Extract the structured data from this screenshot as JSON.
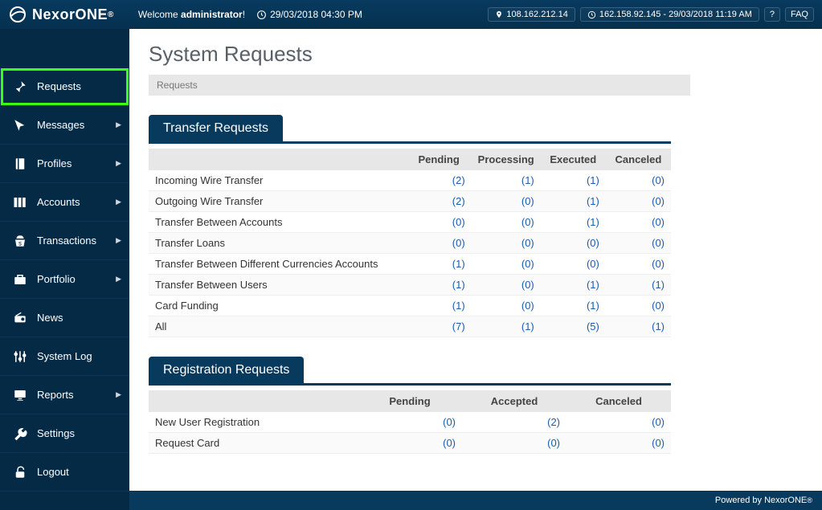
{
  "brand": {
    "name": "NexorONE",
    "reg": "®"
  },
  "header": {
    "welcome_prefix": "Welcome ",
    "welcome_user": "administrator",
    "welcome_suffix": "!",
    "datetime": "29/03/2018 04:30 PM",
    "ip": "108.162.212.14",
    "last_login": "162.158.92.145 - 29/03/2018 11:19 AM",
    "help": "?",
    "faq": "FAQ"
  },
  "nav": [
    {
      "label": "Requests",
      "icon": "pin",
      "arrow": false,
      "active": true
    },
    {
      "label": "Messages",
      "icon": "cursor",
      "arrow": true,
      "active": false
    },
    {
      "label": "Profiles",
      "icon": "book",
      "arrow": true,
      "active": false
    },
    {
      "label": "Accounts",
      "icon": "cards",
      "arrow": true,
      "active": false
    },
    {
      "label": "Transactions",
      "icon": "bag",
      "arrow": true,
      "active": false
    },
    {
      "label": "Portfolio",
      "icon": "briefcase",
      "arrow": true,
      "active": false
    },
    {
      "label": "News",
      "icon": "radio",
      "arrow": false,
      "active": false
    },
    {
      "label": "System Log",
      "icon": "sliders",
      "arrow": false,
      "active": false
    },
    {
      "label": "Reports",
      "icon": "screen",
      "arrow": true,
      "active": false
    },
    {
      "label": "Settings",
      "icon": "wrench",
      "arrow": false,
      "active": false
    },
    {
      "label": "Logout",
      "icon": "lock",
      "arrow": false,
      "active": false
    }
  ],
  "page": {
    "title": "System Requests",
    "breadcrumb": "Requests"
  },
  "transfer_section": {
    "title": "Transfer Requests",
    "columns": [
      "",
      "Pending",
      "Processing",
      "Executed",
      "Canceled"
    ],
    "rows": [
      {
        "label": "Incoming Wire Transfer",
        "vals": [
          "(2)",
          "(1)",
          "(1)",
          "(0)"
        ]
      },
      {
        "label": "Outgoing Wire Transfer",
        "vals": [
          "(2)",
          "(0)",
          "(1)",
          "(0)"
        ]
      },
      {
        "label": "Transfer Between Accounts",
        "vals": [
          "(0)",
          "(0)",
          "(1)",
          "(0)"
        ]
      },
      {
        "label": "Transfer Loans",
        "vals": [
          "(0)",
          "(0)",
          "(0)",
          "(0)"
        ]
      },
      {
        "label": "Transfer Between Different Currencies Accounts",
        "vals": [
          "(1)",
          "(0)",
          "(0)",
          "(0)"
        ]
      },
      {
        "label": "Transfer Between Users",
        "vals": [
          "(1)",
          "(0)",
          "(1)",
          "(1)"
        ]
      },
      {
        "label": "Card Funding",
        "vals": [
          "(1)",
          "(0)",
          "(1)",
          "(0)"
        ]
      },
      {
        "label": "All",
        "vals": [
          "(7)",
          "(1)",
          "(5)",
          "(1)"
        ]
      }
    ]
  },
  "registration_section": {
    "title": "Registration Requests",
    "columns": [
      "",
      "Pending",
      "Accepted",
      "Canceled"
    ],
    "rows": [
      {
        "label": "New User Registration",
        "vals": [
          "(0)",
          "(2)",
          "(0)"
        ]
      },
      {
        "label": "Request Card",
        "vals": [
          "(0)",
          "(0)",
          "(0)"
        ]
      }
    ]
  },
  "footer": {
    "text": "Powered by NexorONE",
    "reg": "®"
  }
}
